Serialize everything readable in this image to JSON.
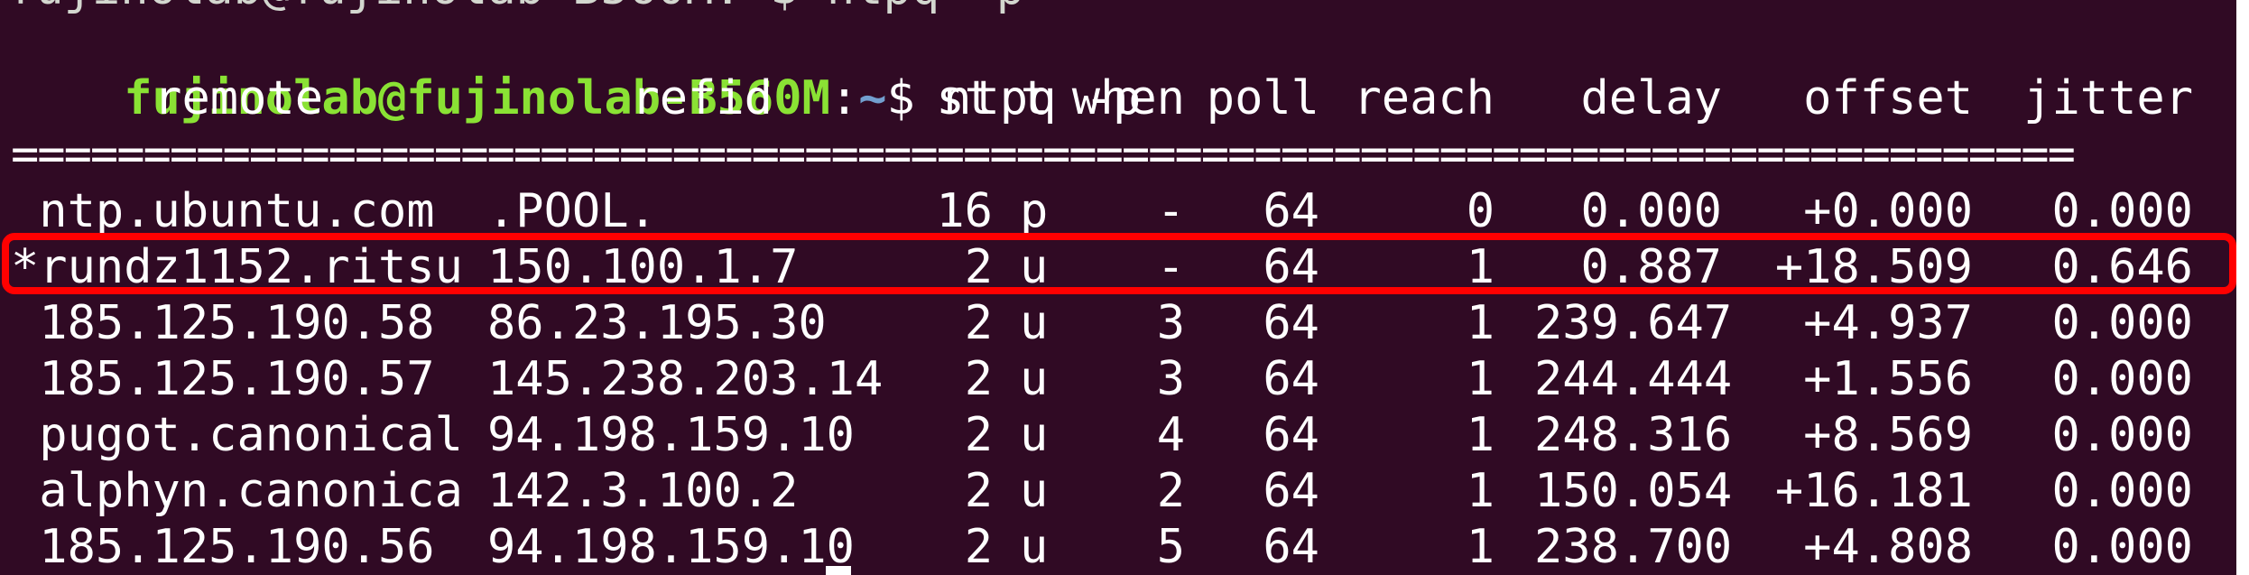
{
  "terminal": {
    "prompt": {
      "user_host": "fujinolab@fujinolab-B560M",
      "separator": ":",
      "path": "~",
      "symbol": "$ ",
      "command": "ntpq -p"
    },
    "partial_line": "fujinolab@fujinolab-B560M:~$ ntpq -p",
    "columns": {
      "remote": "remote",
      "refid": "refid",
      "st": "st",
      "t": "t",
      "when": "when",
      "poll": "poll",
      "reach": "reach",
      "delay": "delay",
      "offset": "offset",
      "jitter": "jitter"
    },
    "separator_line": "==============================================================================",
    "rows": [
      {
        "remote": " ntp.ubuntu.com",
        "refid": ".POOL.",
        "st": "16",
        "t": "p",
        "when": "-",
        "poll": "64",
        "reach": "0",
        "delay": "0.000",
        "offset": "+0.000",
        "jitter": "0.000"
      },
      {
        "remote": "*rundz1152.ritsu",
        "refid": "150.100.1.7",
        "st": "2",
        "t": "u",
        "when": "-",
        "poll": "64",
        "reach": "1",
        "delay": "0.887",
        "offset": "+18.509",
        "jitter": "0.646"
      },
      {
        "remote": " 185.125.190.58",
        "refid": "86.23.195.30",
        "st": "2",
        "t": "u",
        "when": "3",
        "poll": "64",
        "reach": "1",
        "delay": "239.647",
        "offset": "+4.937",
        "jitter": "0.000"
      },
      {
        "remote": " 185.125.190.57",
        "refid": "145.238.203.14",
        "st": "2",
        "t": "u",
        "when": "3",
        "poll": "64",
        "reach": "1",
        "delay": "244.444",
        "offset": "+1.556",
        "jitter": "0.000"
      },
      {
        "remote": " pugot.canonical",
        "refid": "94.198.159.10",
        "st": "2",
        "t": "u",
        "when": "4",
        "poll": "64",
        "reach": "1",
        "delay": "248.316",
        "offset": "+8.569",
        "jitter": "0.000"
      },
      {
        "remote": " alphyn.canonica",
        "refid": "142.3.100.2",
        "st": "2",
        "t": "u",
        "when": "2",
        "poll": "64",
        "reach": "1",
        "delay": "150.054",
        "offset": "+16.181",
        "jitter": "0.000"
      },
      {
        "remote": " 185.125.190.56",
        "refid": "94.198.159.10",
        "st": "2",
        "t": "u",
        "when": "5",
        "poll": "64",
        "reach": "1",
        "delay": "238.700",
        "offset": "+4.808",
        "jitter": "0.000"
      }
    ],
    "highlighted_row_index": 1,
    "colors": {
      "background": "#300a24",
      "user_host": "#8ae234",
      "path": "#729fcf",
      "text": "#ffffff",
      "highlight_border": "#ff0000"
    }
  }
}
